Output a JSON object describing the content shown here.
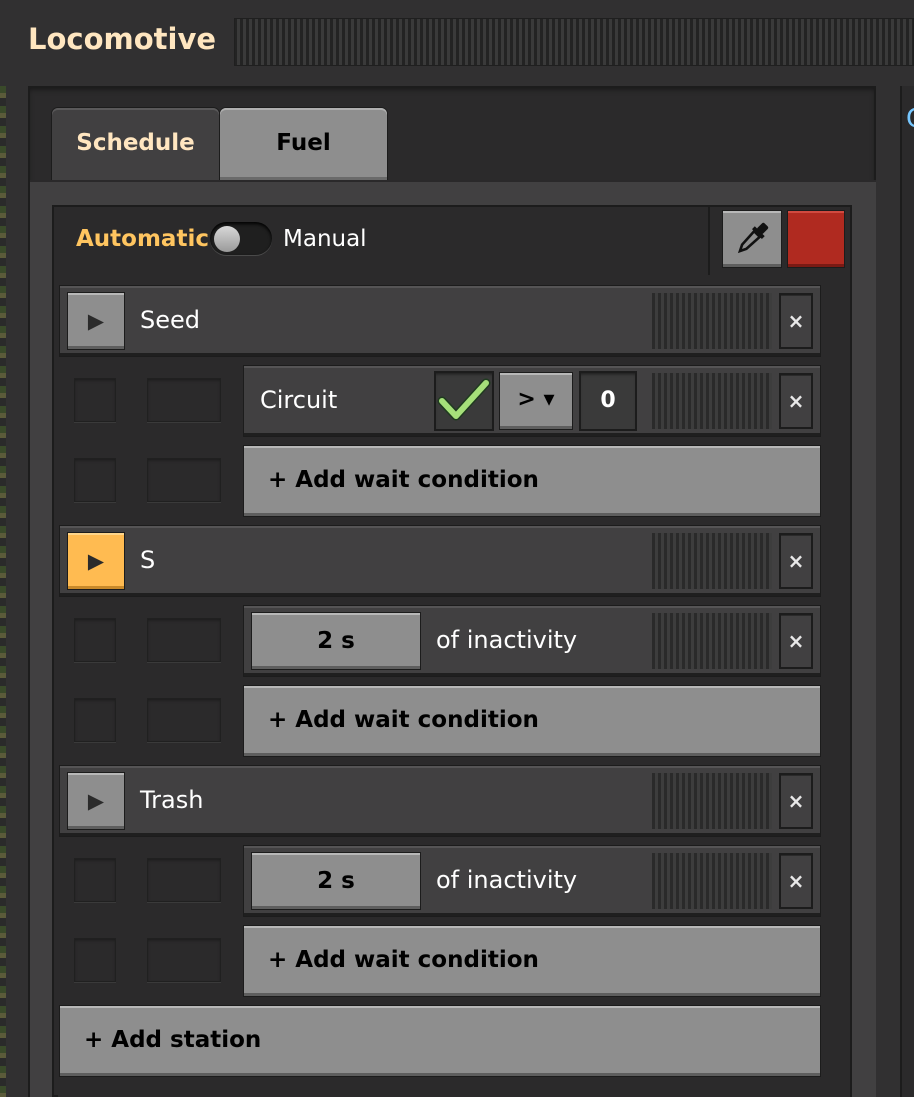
{
  "window": {
    "title": "Locomotive",
    "right_panel_letter": "C"
  },
  "tabs": [
    {
      "label": "Schedule",
      "active": true
    },
    {
      "label": "Fuel",
      "active": false
    }
  ],
  "mode": {
    "automatic_label": "Automatic",
    "manual_label": "Manual",
    "state": "automatic"
  },
  "train_color": "#b02a20",
  "icons": {
    "play": "▶",
    "close": "×",
    "check": "check-icon",
    "eyedropper": "eyedropper-icon"
  },
  "stations": [
    {
      "name": "Seed",
      "active": false,
      "conditions": [
        {
          "type": "circuit",
          "label": "Circuit",
          "comparator": ">",
          "dropdown_arrow": "▾",
          "constant": "0",
          "signal_checked": true
        }
      ],
      "add_wait_label": "+ Add wait condition"
    },
    {
      "name": "S",
      "active": true,
      "conditions": [
        {
          "type": "inactivity",
          "time": "2 s",
          "label": "of inactivity"
        }
      ],
      "add_wait_label": "+ Add wait condition"
    },
    {
      "name": "Trash",
      "active": false,
      "conditions": [
        {
          "type": "inactivity",
          "time": "2 s",
          "label": "of inactivity"
        }
      ],
      "add_wait_label": "+ Add wait condition"
    }
  ],
  "add_station_label": "+ Add station"
}
